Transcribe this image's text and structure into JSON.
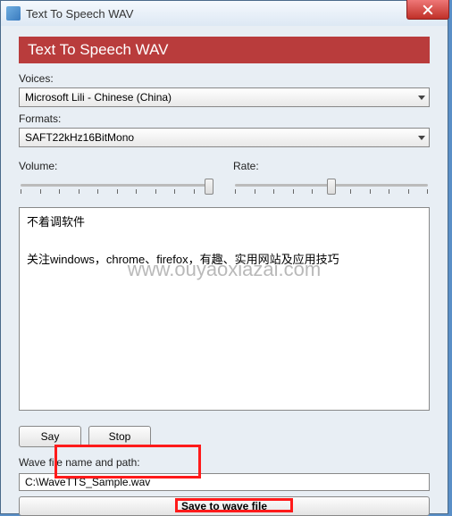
{
  "window": {
    "title": "Text To Speech WAV"
  },
  "banner": {
    "title": "Text To Speech WAV"
  },
  "voices": {
    "label": "Voices:",
    "selected": "Microsoft Lili - Chinese (China)"
  },
  "formats": {
    "label": "Formats:",
    "selected": "SAFT22kHz16BitMono"
  },
  "volume": {
    "label": "Volume:"
  },
  "rate": {
    "label": "Rate:"
  },
  "text_input": {
    "value": "不着调软件\n\n关注windows，chrome、firefox，有趣、实用网站及应用技巧"
  },
  "buttons": {
    "say": "Say",
    "stop": "Stop",
    "save": "Save to wave file"
  },
  "wavefile": {
    "label": "Wave file name and path:",
    "value": "C:\\WaveTTS_Sample.wav"
  },
  "watermark": "www.ouyaoxiazai.com"
}
